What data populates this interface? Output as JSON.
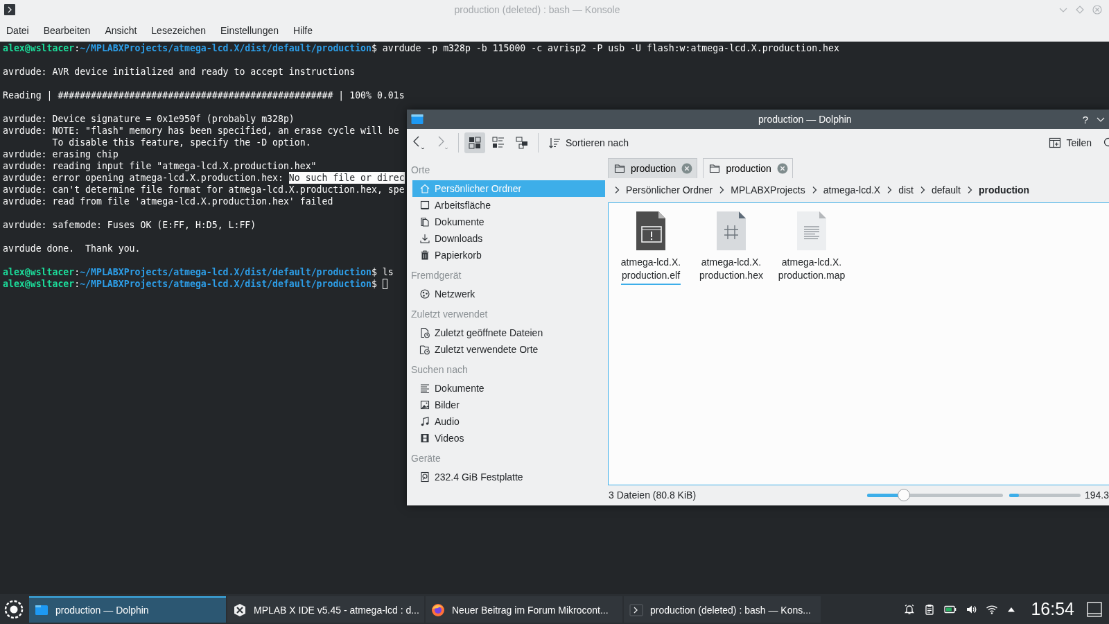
{
  "konsole": {
    "title": "production (deleted) : bash — Konsole",
    "menu": [
      "Datei",
      "Bearbeiten",
      "Ansicht",
      "Lesezeichen",
      "Einstellungen",
      "Hilfe"
    ],
    "lines": [
      {
        "kind": "output",
        "segments": [
          {
            "kind": "user",
            "text": "alex@wsltacer"
          },
          {
            "kind": "text",
            "text": ":"
          },
          {
            "kind": "path",
            "text": "~/MPLABXProjects/atmega-lcd.X/dist/default/production"
          },
          {
            "kind": "text",
            "text": "$ avrdude -p m328p -b 115000 -c avrisp2 -P usb -U flash:w:atmega-lcd.X.production.hex"
          }
        ]
      },
      {
        "kind": "blank"
      },
      {
        "kind": "output",
        "segments": [
          {
            "kind": "text",
            "text": "avrdude: AVR device initialized and ready to accept instructions"
          }
        ]
      },
      {
        "kind": "blank"
      },
      {
        "kind": "output",
        "segments": [
          {
            "kind": "text",
            "text": "Reading | ################################################## | 100% 0.01s"
          }
        ]
      },
      {
        "kind": "blank"
      },
      {
        "kind": "output",
        "segments": [
          {
            "kind": "text",
            "text": "avrdude: Device signature = 0x1e950f (probably m328p)"
          }
        ]
      },
      {
        "kind": "output",
        "segments": [
          {
            "kind": "text",
            "text": "avrdude: NOTE: \"flash\" memory has been specified, an erase cycle will be"
          }
        ]
      },
      {
        "kind": "output",
        "segments": [
          {
            "kind": "text",
            "text": "         To disable this feature, specify the -D option."
          }
        ]
      },
      {
        "kind": "output",
        "segments": [
          {
            "kind": "text",
            "text": "avrdude: erasing chip"
          }
        ]
      },
      {
        "kind": "output",
        "segments": [
          {
            "kind": "text",
            "text": "avrdude: reading input file \"atmega-lcd.X.production.hex\""
          }
        ]
      },
      {
        "kind": "output",
        "segments": [
          {
            "kind": "text",
            "text": "avrdude: error opening atmega-lcd.X.production.hex: "
          },
          {
            "kind": "selected",
            "text": "No such file or direc"
          }
        ]
      },
      {
        "kind": "output",
        "segments": [
          {
            "kind": "text",
            "text": "avrdude: can't determine file format for atmega-lcd.X.production.hex, spe"
          }
        ]
      },
      {
        "kind": "output",
        "segments": [
          {
            "kind": "text",
            "text": "avrdude: read from file 'atmega-lcd.X.production.hex' failed"
          }
        ]
      },
      {
        "kind": "blank"
      },
      {
        "kind": "output",
        "segments": [
          {
            "kind": "text",
            "text": "avrdude: safemode: Fuses OK (E:FF, H:D5, L:FF)"
          }
        ]
      },
      {
        "kind": "blank"
      },
      {
        "kind": "output",
        "segments": [
          {
            "kind": "text",
            "text": "avrdude done.  Thank you."
          }
        ]
      },
      {
        "kind": "blank"
      },
      {
        "kind": "output",
        "segments": [
          {
            "kind": "user",
            "text": "alex@wsltacer"
          },
          {
            "kind": "text",
            "text": ":"
          },
          {
            "kind": "path",
            "text": "~/MPLABXProjects/atmega-lcd.X/dist/default/production"
          },
          {
            "kind": "text",
            "text": "$ ls"
          }
        ]
      },
      {
        "kind": "output",
        "segments": [
          {
            "kind": "user",
            "text": "alex@wsltacer"
          },
          {
            "kind": "text",
            "text": ":"
          },
          {
            "kind": "path",
            "text": "~/MPLABXProjects/atmega-lcd.X/dist/default/production"
          },
          {
            "kind": "text",
            "text": "$"
          }
        ],
        "cursor": true
      }
    ]
  },
  "dolphin": {
    "title": "production — Dolphin",
    "help_button": "?",
    "toolbar": {
      "sort_button": "Sortieren nach",
      "share_button": "Teilen",
      "view_modes": [
        {
          "kind": "icons",
          "selected": true
        },
        {
          "kind": "compact",
          "selected": false
        },
        {
          "kind": "details",
          "selected": false
        }
      ]
    },
    "places": [
      {
        "heading": "Orte",
        "items": [
          {
            "label": "Persönlicher Ordner",
            "kind": "home",
            "selected": true
          },
          {
            "label": "Arbeitsfläche",
            "kind": "desktop",
            "selected": false
          },
          {
            "label": "Dokumente",
            "kind": "documents",
            "selected": false
          },
          {
            "label": "Downloads",
            "kind": "download",
            "selected": false
          },
          {
            "label": "Papierkorb",
            "kind": "trash",
            "selected": false
          }
        ]
      },
      {
        "heading": "Fremdgerät",
        "items": [
          {
            "label": "Netzwerk",
            "kind": "network",
            "selected": false
          }
        ]
      },
      {
        "heading": "Zuletzt verwendet",
        "items": [
          {
            "label": "Zuletzt geöffnete Dateien",
            "kind": "recent-file",
            "selected": false
          },
          {
            "label": "Zuletzt verwendete Orte",
            "kind": "recent-folder",
            "selected": false
          }
        ]
      },
      {
        "heading": "Suchen nach",
        "items": [
          {
            "label": "Dokumente",
            "kind": "text",
            "selected": false
          },
          {
            "label": "Bilder",
            "kind": "image",
            "selected": false
          },
          {
            "label": "Audio",
            "kind": "audio",
            "selected": false
          },
          {
            "label": "Videos",
            "kind": "video",
            "selected": false
          }
        ]
      },
      {
        "heading": "Geräte",
        "items": [
          {
            "label": "232.4 GiB Festplatte",
            "kind": "drive",
            "selected": false
          }
        ]
      }
    ],
    "tabs": [
      {
        "label": "production",
        "selected": false
      },
      {
        "label": "production",
        "selected": true
      }
    ],
    "breadcrumb": [
      "Persönlicher Ordner",
      "MPLABXProjects",
      "atmega-lcd.X",
      "dist",
      "default",
      "production"
    ],
    "files": [
      {
        "name": "atmega-lcd.X.\nproduction.elf",
        "kind": "executable",
        "current": true
      },
      {
        "name": "atmega-lcd.X.\nproduction.hex",
        "kind": "hex",
        "current": false
      },
      {
        "name": "atmega-lcd.X.\nproduction.map",
        "kind": "text",
        "current": false
      }
    ],
    "status": {
      "text": "3 Dateien (80.8 KiB)",
      "zoom": {
        "level": 0.27
      },
      "space": {
        "level": 0.14
      },
      "space_text": "194.3"
    }
  },
  "taskbar": {
    "tasks": [
      {
        "label": "production — Dolphin",
        "kind": "folder",
        "selected": true
      },
      {
        "label": "MPLAB X IDE v5.45 - atmega-lcd : d...",
        "kind": "ide",
        "selected": false
      },
      {
        "label": "Neuer Beitrag im Forum Mikrocont...",
        "kind": "browser",
        "selected": false
      },
      {
        "label": "production (deleted) : bash — Kons...",
        "kind": "terminal",
        "selected": false
      }
    ],
    "clock": "16:54"
  }
}
